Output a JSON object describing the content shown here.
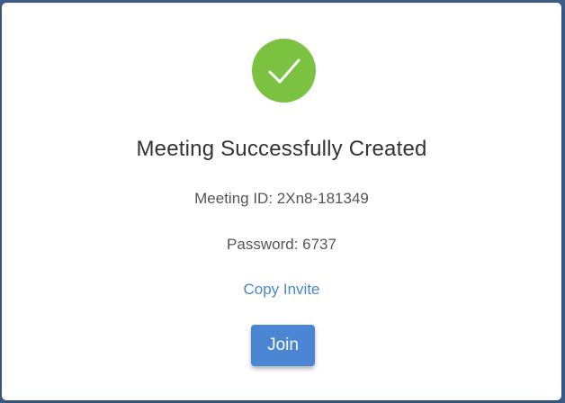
{
  "dialog": {
    "title": "Meeting Successfully Created",
    "meeting_id_text": "Meeting ID: 2Xn8-181349",
    "password_text": "Password: 6737",
    "copy_invite_label": "Copy Invite",
    "join_label": "Join"
  },
  "icons": {
    "success": "checkmark-circle-icon"
  },
  "colors": {
    "backdrop": "#3f5f8c",
    "success_green": "#7bc241",
    "link_blue": "#4a86c8",
    "button_blue": "#4a86d4"
  }
}
